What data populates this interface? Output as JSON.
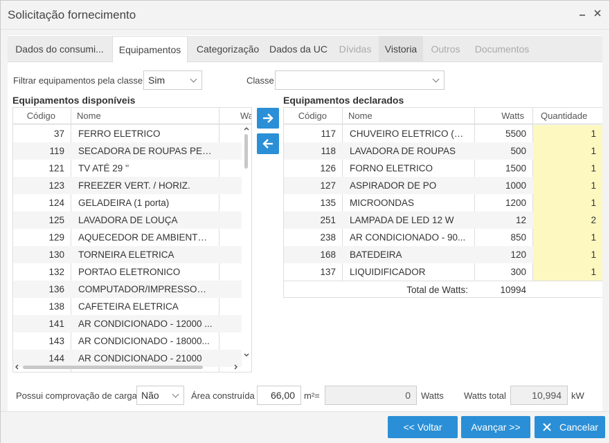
{
  "window": {
    "title": "Solicitação fornecimento"
  },
  "tabs": [
    {
      "label": "Dados do consumi..."
    },
    {
      "label": "Equipamentos"
    },
    {
      "label": "Categorização"
    },
    {
      "label": "Dados da UC"
    },
    {
      "label": "Dívidas"
    },
    {
      "label": "Vistoria"
    },
    {
      "label": "Outros"
    },
    {
      "label": "Documentos"
    }
  ],
  "filter": {
    "label": "Filtrar equipamentos pela classe",
    "value": "Sim",
    "class_label": "Classe",
    "class_value": ""
  },
  "available": {
    "title": "Equipamentos disponíveis",
    "columns": [
      "Código",
      "Nome",
      "Wa"
    ],
    "rows": [
      [
        "37",
        "FERRO ELETRICO"
      ],
      [
        "119",
        "SECADORA DE ROUPAS PEQ..."
      ],
      [
        "121",
        "TV ATÉ 29 ''"
      ],
      [
        "123",
        "FREEZER VERT. / HORIZ."
      ],
      [
        "124",
        "GELADEIRA (1 porta)"
      ],
      [
        "125",
        "LAVADORA DE LOUÇA"
      ],
      [
        "129",
        "AQUECEDOR DE AMBIENTE -..."
      ],
      [
        "130",
        "TORNEIRA ELETRICA"
      ],
      [
        "132",
        "PORTAO ELETRONICO"
      ],
      [
        "136",
        "COMPUTADOR/IMPRESSORA..."
      ],
      [
        "138",
        "CAFETEIRA ELETRICA"
      ],
      [
        "141",
        "AR CONDICIONADO - 12000 ..."
      ],
      [
        "143",
        "AR CONDICIONADO - 18000..."
      ],
      [
        "144",
        "AR CONDICIONADO - 21000"
      ]
    ]
  },
  "declared": {
    "title": "Equipamentos declarados",
    "columns": [
      "Código",
      "Nome",
      "Watts",
      "Quantidade"
    ],
    "rows": [
      [
        "117",
        "CHUVEIRO ELETRICO (OU...",
        "5500",
        "1"
      ],
      [
        "118",
        "LAVADORA DE ROUPAS",
        "500",
        "1"
      ],
      [
        "126",
        "FORNO ELETRICO",
        "1500",
        "1"
      ],
      [
        "127",
        "ASPIRADOR DE PO",
        "1000",
        "1"
      ],
      [
        "135",
        "MICROONDAS",
        "1200",
        "1"
      ],
      [
        "251",
        "LAMPADA DE LED 12 W",
        "12",
        "2"
      ],
      [
        "238",
        "AR CONDICIONADO - 90...",
        "850",
        "1"
      ],
      [
        "168",
        "BATEDEIRA",
        "120",
        "1"
      ],
      [
        "137",
        "LIQUIDIFICADOR",
        "300",
        "1"
      ]
    ],
    "total_label": "Total de Watts:",
    "total_value": "10994"
  },
  "bottom": {
    "load_label": "Possui comprovação de carga",
    "load_value": "Não",
    "area_label": "Área construída",
    "area_value": "66,00",
    "area_unit": "m²=",
    "watts_value": "0",
    "watts_unit": "Watts",
    "watts_total_label": "Watts total",
    "watts_total_value": "10,994",
    "kw_unit": "kW"
  },
  "buttons": {
    "back": "<< Voltar",
    "next": "Avançar >>",
    "cancel": "Cancelar"
  }
}
